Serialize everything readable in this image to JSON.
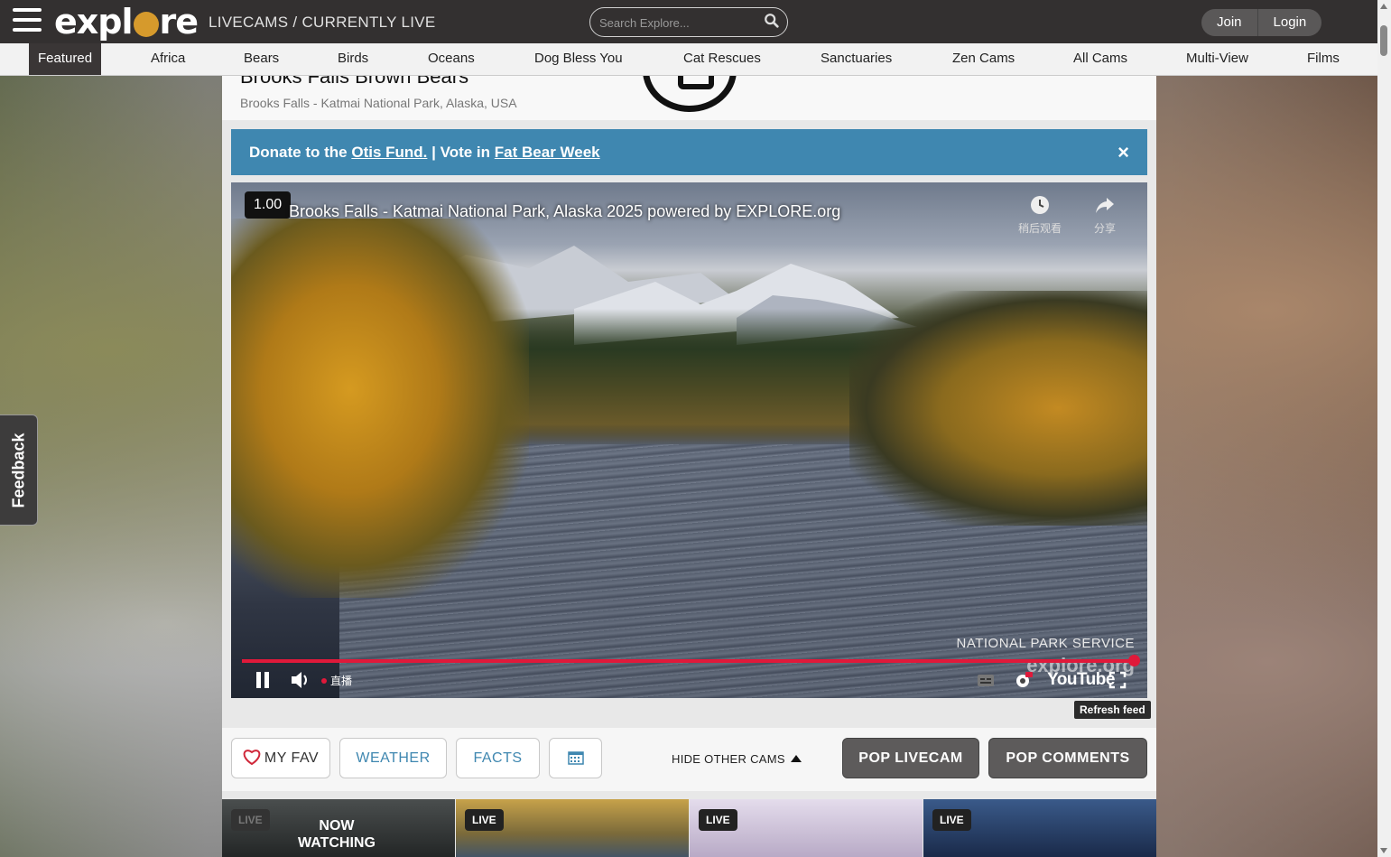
{
  "header": {
    "logo_text": "explore",
    "breadcrumb": "LIVECAMS / CURRENTLY LIVE",
    "search_placeholder": "Search Explore...",
    "join_label": "Join",
    "login_label": "Login"
  },
  "nav": {
    "items": [
      "Featured",
      "Africa",
      "Bears",
      "Birds",
      "Oceans",
      "Dog Bless You",
      "Cat Rescues",
      "Sanctuaries",
      "Zen Cams",
      "All Cams",
      "Multi-View",
      "Films"
    ],
    "active": "Featured"
  },
  "feedback_label": "Feedback",
  "cam": {
    "title": "Brooks Falls Brown Bears",
    "location": "Brooks Falls - Katmai National Park, Alaska, USA"
  },
  "banner": {
    "donate_prefix": "Donate to the",
    "donate_link": "Otis Fund.",
    "separator": "|",
    "vote_prefix": "Vote in",
    "vote_link": "Fat Bear Week",
    "close": "×"
  },
  "video": {
    "speed": "1.00",
    "title": "Brooks Falls - Katmai National Park, Alaska 2025 powered by EXPLORE.org",
    "watch_later": "稍后观看",
    "share": "分享",
    "credit": "NATIONAL PARK SERVICE",
    "watermark": "explore.org",
    "live_label": "直播",
    "youtube_label": "YouTube",
    "progress": 1.0
  },
  "refresh_label": "Refresh feed",
  "toolbar": {
    "fav_label": "MY FAV",
    "weather_label": "WEATHER",
    "facts_label": "FACTS",
    "hide_cams_label": "HIDE OTHER CAMS",
    "pop_livecam_label": "POP LIVECAM",
    "pop_comments_label": "POP COMMENTS"
  },
  "thumbnails": [
    {
      "badge": "LIVE",
      "caption_line1": "NOW",
      "caption_line2": "WATCHING",
      "color": "#2f3232"
    },
    {
      "badge": "LIVE",
      "color": "#9a7a2e"
    },
    {
      "badge": "LIVE",
      "color": "#c9bfd4"
    },
    {
      "badge": "LIVE",
      "color": "#2c4a7a"
    }
  ],
  "colors": {
    "accent": "#3f87b0",
    "header_bg": "#333030",
    "progress": "#e0193a"
  }
}
